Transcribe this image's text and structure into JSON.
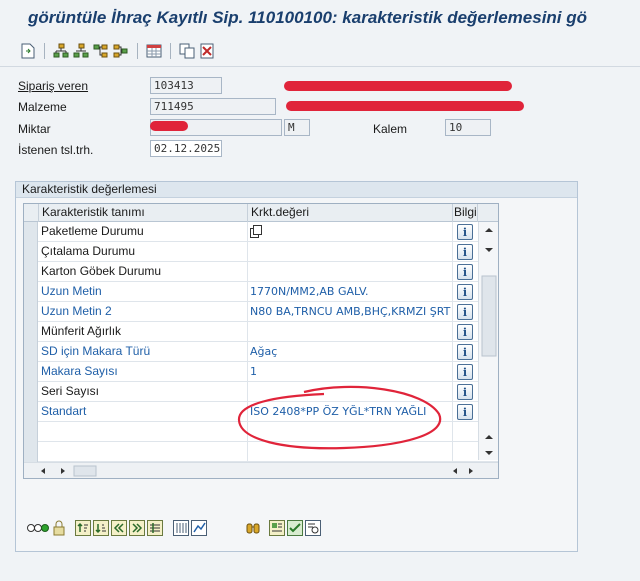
{
  "window": {
    "title": "görüntüle İhraç Kayıtlı Sip. 110100100: karakteristik değerlemesini gö"
  },
  "header": {
    "siparis_veren_label": "Sipariş veren",
    "siparis_veren_value": "103413",
    "malzeme_label": "Malzeme",
    "malzeme_value": "711495",
    "miktar_label": "Miktar",
    "miktar_unit": "M",
    "kalem_label": "Kalem",
    "kalem_value": "10",
    "istenen_label": "İstenen tsl.trh.",
    "istenen_value": "02.12.2025"
  },
  "group": {
    "title": "Karakteristik değerlemesi"
  },
  "table": {
    "columns": [
      "Karakteristik tanımı",
      "Krkt.değeri",
      "Bilgi"
    ],
    "rows": [
      {
        "name": "Paketleme Durumu",
        "value": "",
        "style": "black"
      },
      {
        "name": "Çıtalama Durumu",
        "value": "",
        "style": "black"
      },
      {
        "name": "Karton Göbek Durumu",
        "value": "",
        "style": "black"
      },
      {
        "name": "Uzun Metin",
        "value": "1770N/MM2,AB GALV.",
        "style": "blue"
      },
      {
        "name": "Uzun Metin 2",
        "value": "N80 BA,TRNCU AMB,BHÇ,KRMZI ŞRT",
        "style": "blue"
      },
      {
        "name": "Münferit Ağırlık",
        "value": "",
        "style": "black"
      },
      {
        "name": "SD için Makara Türü",
        "value": "Ağaç",
        "style": "blue"
      },
      {
        "name": "Makara Sayısı",
        "value": "1",
        "style": "blue"
      },
      {
        "name": "Seri Sayısı",
        "value": "",
        "style": "black"
      },
      {
        "name": "Standart",
        "value": "ISO 2408*PP ÖZ YĞL*TRN YAĞLI",
        "style": "blue"
      }
    ],
    "info_glyph": "i"
  },
  "colors": {
    "accent": "#1f5fa8",
    "annotation": "#e0243a",
    "title": "#1a3f6e"
  }
}
